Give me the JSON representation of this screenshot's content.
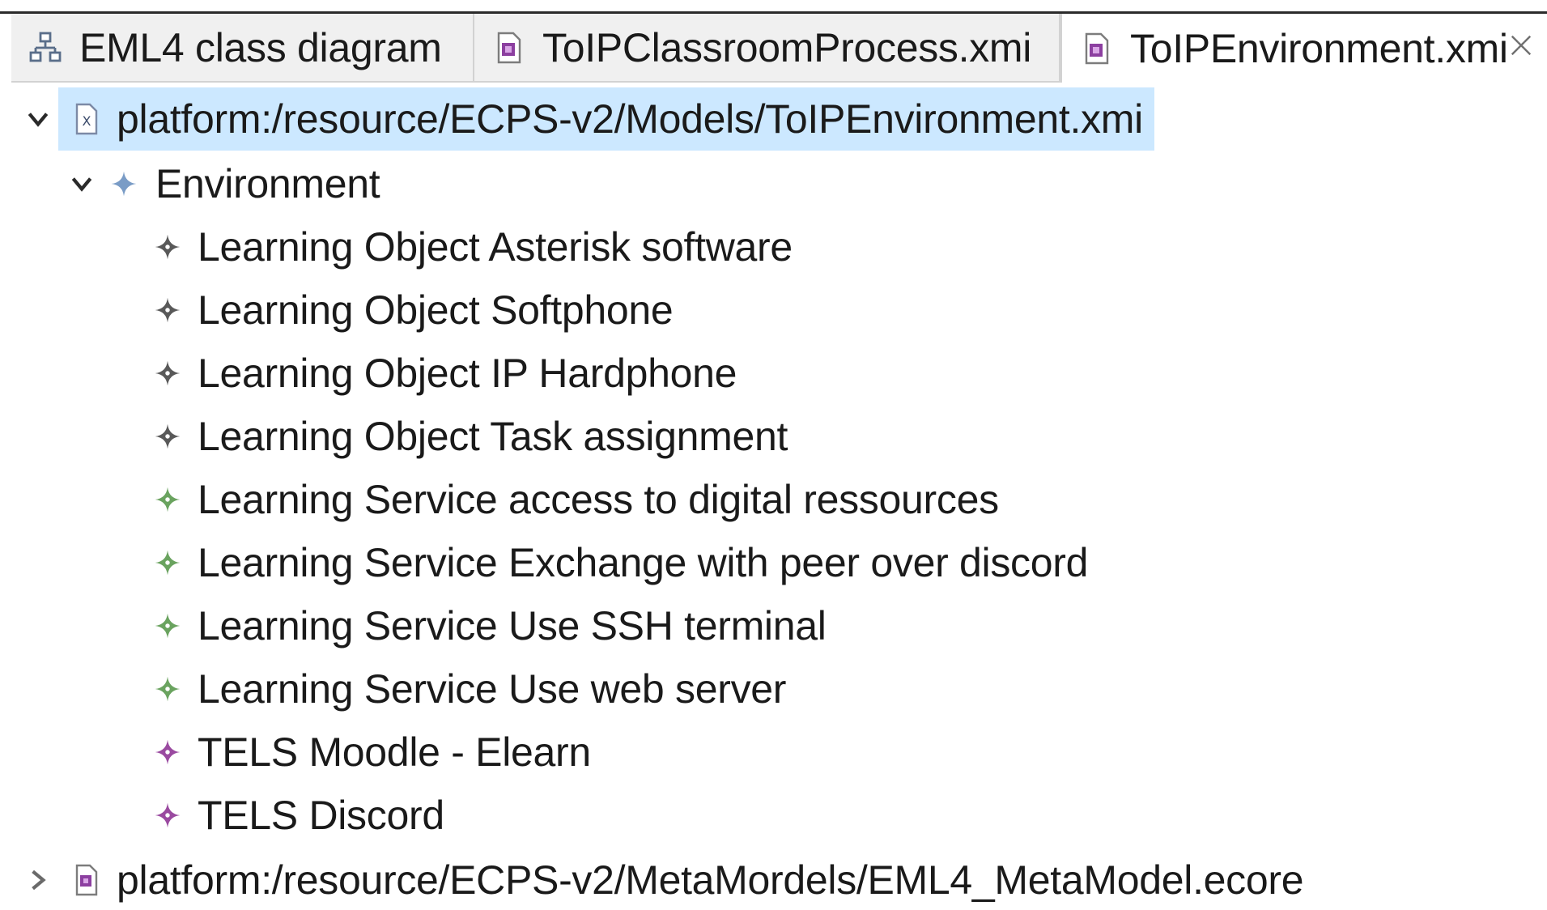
{
  "tabs": [
    {
      "label": "EML4 class diagram",
      "icon": "class-diagram-icon",
      "active": false
    },
    {
      "label": "ToIPClassroomProcess.xmi",
      "icon": "model-file-icon",
      "active": false
    },
    {
      "label": "ToIPEnvironment.xmi",
      "icon": "model-file-icon",
      "active": true
    }
  ],
  "tree": {
    "root": {
      "label": "platform:/resource/ECPS-v2/Models/ToIPEnvironment.xmi",
      "icon": "xmi-file-icon",
      "expanded": true,
      "selected": true
    },
    "environment": {
      "label": "Environment",
      "icon": "environment-diamond-icon",
      "expanded": true
    },
    "children": [
      {
        "label": "Learning Object Asterisk software",
        "icon": "learning-object-icon",
        "color": "#595959"
      },
      {
        "label": "Learning Object Softphone",
        "icon": "learning-object-icon",
        "color": "#595959"
      },
      {
        "label": "Learning Object IP Hardphone",
        "icon": "learning-object-icon",
        "color": "#595959"
      },
      {
        "label": "Learning Object Task assignment",
        "icon": "learning-object-icon",
        "color": "#595959"
      },
      {
        "label": "Learning Service access to digital ressources",
        "icon": "learning-service-icon",
        "color": "#6aa35f"
      },
      {
        "label": "Learning Service Exchange with peer over discord",
        "icon": "learning-service-icon",
        "color": "#6aa35f"
      },
      {
        "label": "Learning Service Use SSH terminal",
        "icon": "learning-service-icon",
        "color": "#6aa35f"
      },
      {
        "label": "Learning Service Use web server",
        "icon": "learning-service-icon",
        "color": "#6aa35f"
      },
      {
        "label": "TELS Moodle - Elearn",
        "icon": "tels-icon",
        "color": "#9a4aa0"
      },
      {
        "label": "TELS Discord",
        "icon": "tels-icon",
        "color": "#9a4aa0"
      }
    ],
    "second_root": {
      "label": "platform:/resource/ECPS-v2/MetaMordels/EML4_MetaModel.ecore",
      "icon": "ecore-file-icon",
      "expanded": false
    }
  },
  "colors": {
    "selection": "#cce8ff",
    "environment_icon": "#7a9cc6",
    "tab_inactive": "#f0f0f0"
  }
}
